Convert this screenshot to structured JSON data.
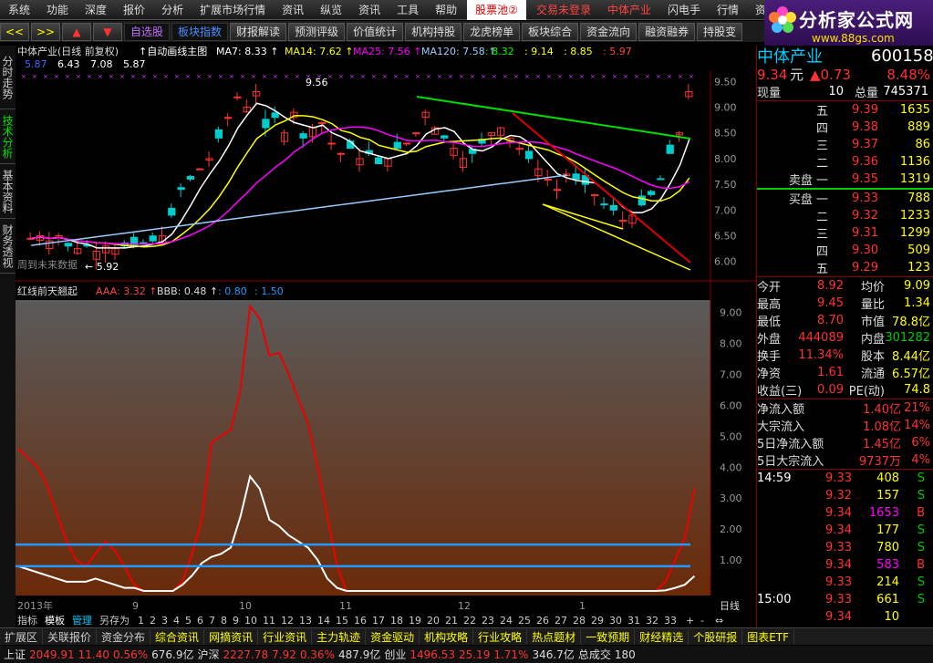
{
  "menubar": {
    "items": [
      "系统",
      "功能",
      "深度",
      "报价",
      "分析",
      "扩展市场行情",
      "资讯",
      "纵览",
      "资讯",
      "工具",
      "帮助"
    ],
    "hot": "股票池",
    "hot_badge": "②",
    "login": "交易未登录",
    "brand": "中体产业",
    "flash": "闪电手",
    "quotes": "行情",
    "more": "资"
  },
  "logo": {
    "title": "分析家公式网",
    "url": "www.88gs.com"
  },
  "toolbar": {
    "nav": [
      "<<",
      ">>",
      "▲",
      "▼"
    ],
    "fav": "自选股",
    "sector": "板块指数",
    "buttons": [
      "财报解读",
      "预测评级",
      "价值统计",
      "机构持股",
      "龙虎榜单",
      "板块综合",
      "资金流向",
      "融资融券",
      "持股变"
    ]
  },
  "leftnav": [
    "分时走势",
    "技术分析",
    "基本资料",
    "财务透视"
  ],
  "main": {
    "title": "中体产业(日线 前复权)",
    "draw": "自动画线主图",
    "ma": [
      {
        "n": "MA7",
        "v": "8.33",
        "c": "#fff"
      },
      {
        "n": "MA14",
        "v": "7.62",
        "c": "#ff0"
      },
      {
        "n": "MA25",
        "v": "7.56",
        "c": "#f0f"
      },
      {
        "n": "MA120",
        "v": "7.58",
        "c": "#9cf"
      }
    ],
    "line2": [
      {
        "t": "5.87",
        "c": "#46f"
      },
      {
        "t": "6.43",
        "c": "#fff"
      },
      {
        "t": "7.08",
        "c": "#fff"
      },
      {
        "t": "5.87",
        "c": "#fff"
      }
    ],
    "line2b": [
      {
        "t": "8.32",
        "c": "#0f0"
      },
      {
        "t": "9.14",
        "c": "#ff0"
      },
      {
        "t": "8.85",
        "c": "#ff0"
      },
      {
        "t": "5.97",
        "c": "#f44"
      }
    ],
    "hi": "9.56",
    "lo": "5.92",
    "future": "周到未来数据",
    "yaxis": [
      "9.50",
      "9.00",
      "8.50",
      "8.00",
      "7.50",
      "7.00",
      "6.50",
      "6.00"
    ]
  },
  "sub": {
    "title": "红线前天翘起",
    "aaa": "AAA: 3.32",
    "bbb": "BBB: 0.48",
    "v1": "0.80",
    "v2": "1.50",
    "yaxis": [
      "9.00",
      "8.00",
      "7.00",
      "6.00",
      "5.00",
      "4.00",
      "3.00",
      "2.00",
      "1.00"
    ]
  },
  "xaxis": {
    "labels": [
      "2013年",
      "9",
      "10",
      "11",
      "12",
      "1"
    ],
    "period": "日线"
  },
  "tabs": {
    "items": [
      "指标",
      "模板",
      "管理",
      "另存为"
    ],
    "nums": [
      "1",
      "2",
      "3",
      "4",
      "5",
      "6",
      "7",
      "8",
      "9",
      "10",
      "11",
      "12",
      "13",
      "14",
      "15",
      "16",
      "17",
      "18",
      "19",
      "20",
      "21",
      "22",
      "23",
      "24",
      "25",
      "26",
      "27",
      "28",
      "29",
      "30",
      "31",
      "32",
      "33"
    ],
    "end": [
      "+",
      "-",
      "⇔"
    ]
  },
  "quote": {
    "name": "中体产业",
    "code": "600158",
    "price": "9.34",
    "unit": "元",
    "chg": "▲0.73",
    "pct": "8.48%",
    "vol_l": "现量",
    "vol": "10",
    "tot_l": "总量",
    "tot": "745371",
    "asks": [
      [
        "五",
        "9.39",
        "1635"
      ],
      [
        "四",
        "9.38",
        "889"
      ],
      [
        "三",
        "9.37",
        "86"
      ],
      [
        "二",
        "9.36",
        "1136"
      ],
      [
        "卖盘 一",
        "9.35",
        "1319"
      ]
    ],
    "bids": [
      [
        "买盘 一",
        "9.33",
        "788"
      ],
      [
        "二",
        "9.32",
        "1233"
      ],
      [
        "三",
        "9.31",
        "1299"
      ],
      [
        "四",
        "9.30",
        "509"
      ],
      [
        "五",
        "9.29",
        "123"
      ]
    ],
    "stats": [
      [
        "今开",
        "8.92",
        "均价",
        "9.09"
      ],
      [
        "最高",
        "9.45",
        "量比",
        "1.34"
      ],
      [
        "最低",
        "8.70",
        "市值",
        "78.8亿"
      ],
      [
        "外盘",
        "444089",
        "内盘",
        "301282"
      ],
      [
        "换手",
        "11.34%",
        "股本",
        "8.44亿"
      ],
      [
        "净资",
        "1.61",
        "流通",
        "6.57亿"
      ],
      [
        "收益(三)",
        "0.09",
        "PE(动)",
        "74.8"
      ]
    ],
    "flow": [
      [
        "净流入额",
        "1.40亿",
        "21%"
      ],
      [
        "大宗流入",
        "1.08亿",
        "14%"
      ],
      [
        "5日净流入额",
        "1.45亿",
        "6%"
      ],
      [
        "5日大宗流入",
        "9737万",
        "4%"
      ]
    ],
    "ticks": [
      [
        "14:59",
        "9.33",
        "408",
        "S"
      ],
      [
        "",
        "9.32",
        "157",
        "S"
      ],
      [
        "",
        "9.34",
        "1653",
        "B"
      ],
      [
        "",
        "9.34",
        "177",
        "S"
      ],
      [
        "",
        "9.33",
        "780",
        "S"
      ],
      [
        "",
        "9.34",
        "583",
        "B"
      ],
      [
        "",
        "9.33",
        "214",
        "S"
      ],
      [
        "15:00",
        "9.33",
        "661",
        "S"
      ],
      [
        "",
        "9.34",
        "10",
        ""
      ]
    ]
  },
  "bottombar": [
    "扩展区",
    "关联报价",
    "资金分布",
    "综合资讯",
    "网摘资讯",
    "行业资讯",
    "主力轨迹",
    "资金驱动",
    "机构攻略",
    "行业攻略",
    "热点题材",
    "一致预期",
    "财经精选",
    "个股研报",
    "图表ETF"
  ],
  "status": {
    "sh": "上证",
    "sh_v": "2049.91",
    "sh_c": "11.40",
    "sh_p": "0.56%",
    "sh_a": "676.9亿",
    "sz": "沪深",
    "sz_v": "2227.78",
    "sz_c": "7.92",
    "sz_p": "0.36%",
    "sz_a": "487.9亿",
    "cy": "创业",
    "cy_v": "1496.53",
    "cy_c": "25.19",
    "cy_p": "1.71%",
    "cy_a": "346.7亿",
    "deal": "总成交",
    "num": "180"
  }
}
